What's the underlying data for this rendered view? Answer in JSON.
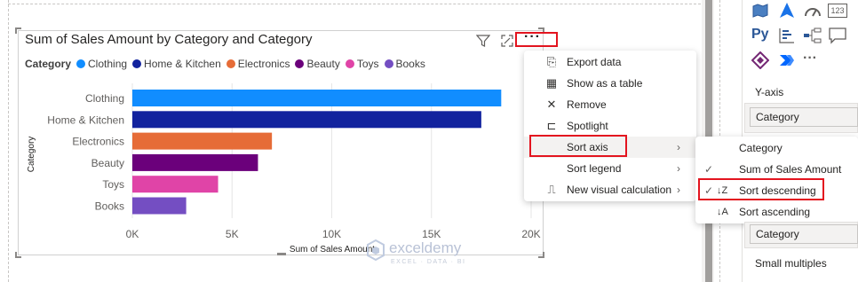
{
  "visual": {
    "title": "Sum of Sales Amount by Category and Category",
    "legend_title": "Category",
    "more_label": "···",
    "filter_icon": "filter-icon",
    "focus_icon": "focus-mode-icon"
  },
  "legend": [
    {
      "label": "Clothing",
      "color": "#118dff"
    },
    {
      "label": "Home & Kitchen",
      "color": "#12239e"
    },
    {
      "label": "Electronics",
      "color": "#e66c37"
    },
    {
      "label": "Beauty",
      "color": "#6b007b"
    },
    {
      "label": "Toys",
      "color": "#e044a7"
    },
    {
      "label": "Books",
      "color": "#744ec2"
    }
  ],
  "chart_data": {
    "type": "bar",
    "orientation": "horizontal",
    "title": "Sum of Sales Amount by Category and Category",
    "xlabel": "Sum of Sales Amount",
    "ylabel": "Category",
    "categories": [
      "Clothing",
      "Home & Kitchen",
      "Electronics",
      "Beauty",
      "Toys",
      "Books"
    ],
    "values": [
      18500,
      17500,
      7000,
      6300,
      4300,
      2700
    ],
    "colors": [
      "#118dff",
      "#12239e",
      "#e66c37",
      "#6b007b",
      "#e044a7",
      "#744ec2"
    ],
    "xlim": [
      0,
      20000
    ],
    "xticks": [
      "0K",
      "5K",
      "10K",
      "15K",
      "20K"
    ],
    "grid": true
  },
  "menu": {
    "items": [
      {
        "label": "Export data",
        "icon": "export-icon",
        "glyph": "⎘",
        "arrow": ""
      },
      {
        "label": "Show as a table",
        "icon": "table-icon",
        "glyph": "▦",
        "arrow": ""
      },
      {
        "label": "Remove",
        "icon": "close-icon",
        "glyph": "✕",
        "arrow": ""
      },
      {
        "label": "Spotlight",
        "icon": "spotlight-icon",
        "glyph": "⊏",
        "arrow": ""
      },
      {
        "label": "Sort axis",
        "icon": "",
        "glyph": "",
        "arrow": "›"
      },
      {
        "label": "Sort legend",
        "icon": "",
        "glyph": "",
        "arrow": "›"
      },
      {
        "label": "New visual calculation",
        "icon": "calculation-icon",
        "glyph": "⎍",
        "arrow": "›"
      }
    ]
  },
  "submenu": {
    "items": [
      {
        "label": "Category",
        "checked": "",
        "glyph": ""
      },
      {
        "label": "Sum of Sales Amount",
        "checked": "✓",
        "glyph": ""
      },
      {
        "label": "Sort descending",
        "checked": "✓",
        "glyph": "↓Z"
      },
      {
        "label": "Sort ascending",
        "checked": "",
        "glyph": "↓A"
      }
    ]
  },
  "pane": {
    "y_axis_label": "Y-axis",
    "y_axis_value": "Category",
    "legend_value": "Category",
    "small_multiples_label": "Small multiples",
    "py_label": "Py",
    "more_label": "···",
    "icon_123": "123"
  },
  "watermark": {
    "name": "exceldemy",
    "tagline": "EXCEL · DATA · BI"
  }
}
